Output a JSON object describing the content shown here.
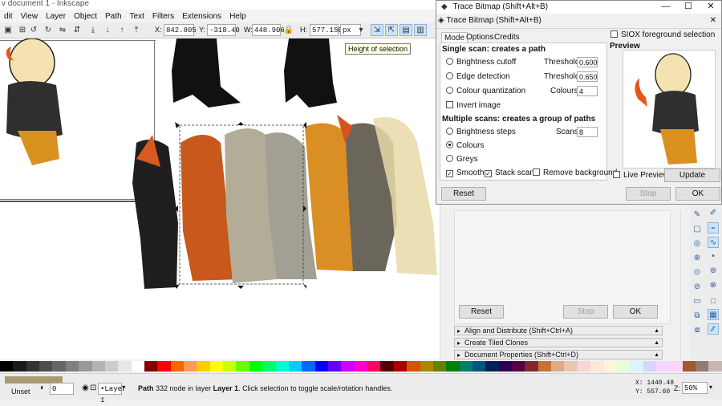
{
  "main_window": {
    "title": "v document 1 - Inkscape",
    "menu": [
      "dit",
      "View",
      "Layer",
      "Object",
      "Path",
      "Text",
      "Filters",
      "Extensions",
      "Help"
    ]
  },
  "toolbar": {
    "x_label": "X:",
    "x_value": "842.805",
    "y_label": "Y:",
    "y_value": "-318.40",
    "w_label": "W:",
    "w_value": "448.906",
    "h_label": "H:",
    "h_value": "577.150",
    "unit": "px",
    "tooltip": "Height of selection"
  },
  "trace_dialog": {
    "title": "Trace Bitmap (Shift+Alt+B)",
    "subtitle": "Trace Bitmap (Shift+Alt+B)",
    "tabs": [
      "Mode",
      "Options",
      "Credits"
    ],
    "single_header": "Single scan: creates a path",
    "brightness": "Brightness cutoff",
    "edge": "Edge detection",
    "colour_quant": "Colour quantization",
    "threshold_label": "Threshold:",
    "threshold1": "0.600",
    "threshold2": "0.650",
    "colours_label": "Colours:",
    "colours_value": "4",
    "invert": "Invert image",
    "multiple_header": "Multiple scans: creates a group of paths",
    "brightness_steps": "Brightness steps",
    "scans_label": "Scans:",
    "scans_value": "8",
    "colours": "Colours",
    "greys": "Greys",
    "smooth": "Smooth",
    "stack": "Stack scans",
    "remove_bg": "Remove background",
    "siox": "SIOX foreground selection",
    "preview_label": "Preview",
    "live_preview": "Live Preview",
    "update": "Update",
    "reset": "Reset",
    "stop": "Stop",
    "ok": "OK"
  },
  "dock": {
    "reset": "Reset",
    "stop": "Stop",
    "ok": "OK",
    "panels": [
      "Align and Distribute (Shift+Ctrl+A)",
      "Create Tiled Clones",
      "Document Properties (Shift+Ctrl+D)"
    ]
  },
  "status": {
    "fill_label": "Unset",
    "opacity_value": "0",
    "layer": "•Layer 1",
    "message_bold": "Path",
    "message": " 332 node in layer ",
    "layer_bold": "Layer 1",
    "message_tail": ". Click selection to toggle scale/rotation handles.",
    "x_coord": "X: 1440.48",
    "y_coord": "Y: 557.60",
    "z_label": "Z:",
    "zoom": "50%"
  },
  "palette_colors": [
    "#000000",
    "#1a1a1a",
    "#333333",
    "#4d4d4d",
    "#666666",
    "#808080",
    "#999999",
    "#b3b3b3",
    "#cccccc",
    "#e6e6e6",
    "#ffffff",
    "#800000",
    "#ff0000",
    "#ff6600",
    "#ff9955",
    "#ffcc00",
    "#ffff00",
    "#ccff00",
    "#66ff00",
    "#00ff00",
    "#00ff66",
    "#00ffcc",
    "#00ccff",
    "#0066ff",
    "#0000ff",
    "#6600ff",
    "#cc00ff",
    "#ff00cc",
    "#ff0066",
    "#550000",
    "#aa0000",
    "#d45500",
    "#aa8800",
    "#668000",
    "#008000",
    "#008066",
    "#005580",
    "#002255",
    "#2b0055",
    "#550044",
    "#7f2a2a",
    "#c87137",
    "#deaa87",
    "#e9c6af",
    "#f4d7d7",
    "#ffe6d5",
    "#fff6d5",
    "#e5ffd5",
    "#d5f6ff",
    "#d5d5ff",
    "#f6d5ff",
    "#ffd5f6",
    "#a05a2c",
    "#917c6f",
    "#c8b7b7"
  ]
}
